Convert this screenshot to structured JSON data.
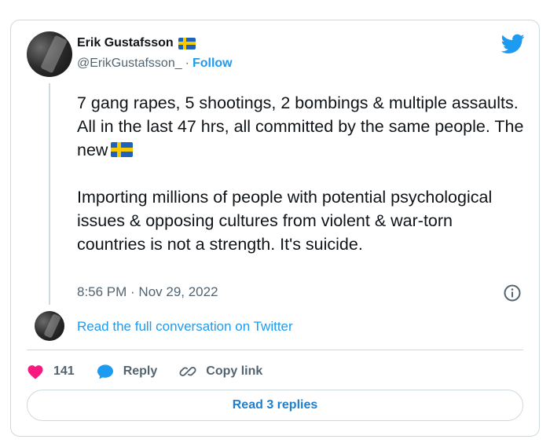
{
  "author": {
    "name": "Erik Gustafsson",
    "handle": "@ErikGustafsson_",
    "separator": "·",
    "follow_label": "Follow",
    "flag_icon": "sweden-flag-icon"
  },
  "tweet": {
    "paragraph1": "7 gang rapes, 5 shootings, 2 bombings & multiple assaults. All in the last 47 hrs, all committed by the same people. The new",
    "paragraph2": "Importing millions of people with potential psychological issues & opposing cultures from violent & war-torn countries is not a strength. It's suicide.",
    "timestamp": "8:56 PM · Nov 29, 2022"
  },
  "conversation": {
    "link_text": "Read the full conversation on Twitter"
  },
  "actions": {
    "like_count": "141",
    "reply_label": "Reply",
    "copy_link_label": "Copy link"
  },
  "replies_button": "Read 3 replies",
  "colors": {
    "accent": "#1d9bf0",
    "like": "#f91880",
    "text": "#0f1419",
    "muted": "#536471",
    "border": "#cfd9de"
  }
}
